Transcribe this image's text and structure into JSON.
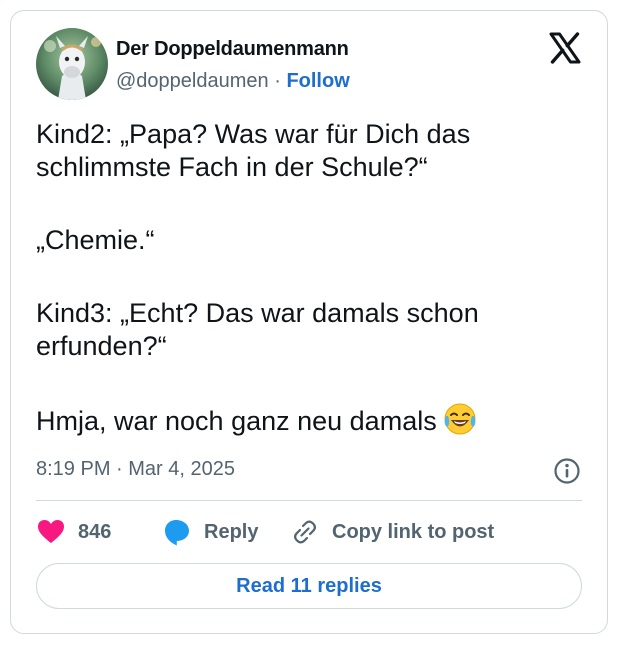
{
  "author": {
    "name": "Der Doppeldaumenmann",
    "handle": "@doppeldaumen",
    "separator": "·",
    "follow_label": "Follow"
  },
  "tweet": {
    "paragraphs": [
      "Kind2: „Papa? Was war für Dich das schlimmste Fach in der Schule?“",
      "„Chemie.“",
      "Kind3: „Echt? Das war damals schon erfunden?“",
      "Hmja, war noch ganz neu damals"
    ],
    "emoji": "laughing-tears-emoji",
    "timestamp": "8:19 PM · Mar 4, 2025"
  },
  "actions": {
    "like_count": "846",
    "reply_label": "Reply",
    "copy_link_label": "Copy link to post"
  },
  "read_replies_label": "Read 11 replies",
  "colors": {
    "link": "#1d6ecf",
    "like": "#f91880",
    "reply_bubble": "#1d9bf0",
    "muted_text": "#536471",
    "border": "#cfd9de"
  },
  "icons": [
    "avatar-image",
    "x-logo-icon",
    "info-icon",
    "heart-icon",
    "reply-bubble-icon",
    "link-icon"
  ]
}
